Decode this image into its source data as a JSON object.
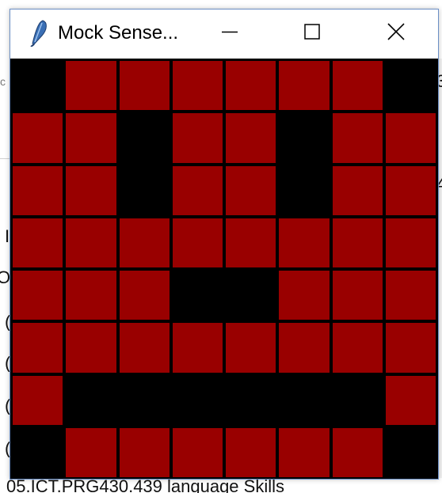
{
  "window": {
    "title": "Mock Sense...",
    "icon": "feather-icon",
    "controls": [
      "minimize-icon",
      "maximize-icon",
      "close-icon"
    ]
  },
  "background": {
    "bottom_text": "05.ICT.PRG430.439 language Skills",
    "left_glyphs": [
      "c",
      "I",
      "O",
      "(",
      "(",
      "(",
      "("
    ],
    "right_glyphs": [
      "3",
      "4"
    ]
  },
  "colors": {
    "on": "#990000",
    "off": "#000000",
    "grid_line": "#000000"
  },
  "led_matrix": {
    "rows": 8,
    "cols": 8,
    "pixels": [
      [
        0,
        1,
        1,
        1,
        1,
        1,
        1,
        0
      ],
      [
        1,
        1,
        0,
        1,
        1,
        0,
        1,
        1
      ],
      [
        1,
        1,
        0,
        1,
        1,
        0,
        1,
        1
      ],
      [
        1,
        1,
        1,
        1,
        1,
        1,
        1,
        1
      ],
      [
        1,
        1,
        1,
        0,
        0,
        1,
        1,
        1
      ],
      [
        1,
        1,
        1,
        1,
        1,
        1,
        1,
        1
      ],
      [
        1,
        0,
        0,
        0,
        0,
        0,
        0,
        1
      ],
      [
        0,
        1,
        1,
        1,
        1,
        1,
        1,
        0
      ]
    ]
  }
}
